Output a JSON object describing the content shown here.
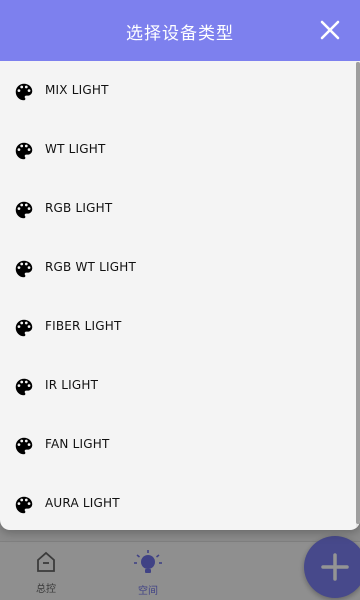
{
  "dialog": {
    "title": "选择设备类型",
    "close_icon": "close-icon",
    "header_color": "#7d80ee",
    "items": [
      {
        "label": "MIX LIGHT",
        "icon": "palette-icon"
      },
      {
        "label": "WT LIGHT",
        "icon": "palette-icon"
      },
      {
        "label": "RGB LIGHT",
        "icon": "palette-icon"
      },
      {
        "label": "RGB WT LIGHT",
        "icon": "palette-icon"
      },
      {
        "label": "FIBER LIGHT",
        "icon": "palette-icon"
      },
      {
        "label": "IR LIGHT",
        "icon": "palette-icon"
      },
      {
        "label": "FAN LIGHT",
        "icon": "palette-icon"
      },
      {
        "label": "AURA LIGHT",
        "icon": "palette-icon"
      }
    ]
  },
  "bottom_nav": {
    "items": [
      {
        "label": "总控",
        "icon": "home-icon",
        "active": false
      },
      {
        "label": "空间",
        "icon": "bulb-icon",
        "active": true
      }
    ],
    "accent_color": "#6f73e6"
  },
  "fab": {
    "icon": "plus-icon",
    "color": "#7a7ff0"
  }
}
